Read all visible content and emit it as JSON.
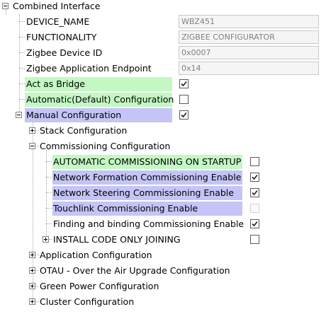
{
  "tree": {
    "root": {
      "label": "Combined Interface"
    },
    "device_name": {
      "label": "DEVICE_NAME",
      "value": "WBZ451"
    },
    "functionality": {
      "label": "FUNCTIONALITY",
      "value": "ZIGBEE CONFIGURATOR"
    },
    "device_id": {
      "label": "Zigbee Device ID",
      "value": "0x0007"
    },
    "app_endpoint": {
      "label": "Zigbee Application Endpoint",
      "value": "0x14"
    },
    "act_as_bridge": {
      "label": "Act as Bridge",
      "checked": true
    },
    "automatic_config": {
      "label": "Automatic(Default) Configuration",
      "checked": false
    },
    "manual_config": {
      "label": "Manual Configuration",
      "checked": true
    },
    "stack_config": {
      "label": "Stack Configuration"
    },
    "commissioning_config": {
      "label": "Commissioning Configuration"
    },
    "auto_commissioning": {
      "label": "AUTOMATIC COMMISSIONING ON STARTUP",
      "checked": false
    },
    "network_formation": {
      "label": "Network Formation Commissioning Enable",
      "checked": true
    },
    "network_steering": {
      "label": "Network Steering Commissioning Enable",
      "checked": true
    },
    "touchlink": {
      "label": "Touchlink Commissioning Enable",
      "checked": false,
      "disabled": true
    },
    "finding_binding": {
      "label": "Finding and binding Commissioning Enable",
      "checked": true
    },
    "install_code": {
      "label": "INSTALL CODE ONLY JOINING",
      "checked": false
    },
    "app_config": {
      "label": "Application Configuration"
    },
    "otau": {
      "label": "OTAU - Over the Air Upgrade Configuration"
    },
    "green_power": {
      "label": "Green Power Configuration"
    },
    "cluster_config": {
      "label": "Cluster Configuration"
    }
  },
  "colors": {
    "green_highlight": "#c3f8c3",
    "blue_highlight": "#c4c4f7"
  }
}
